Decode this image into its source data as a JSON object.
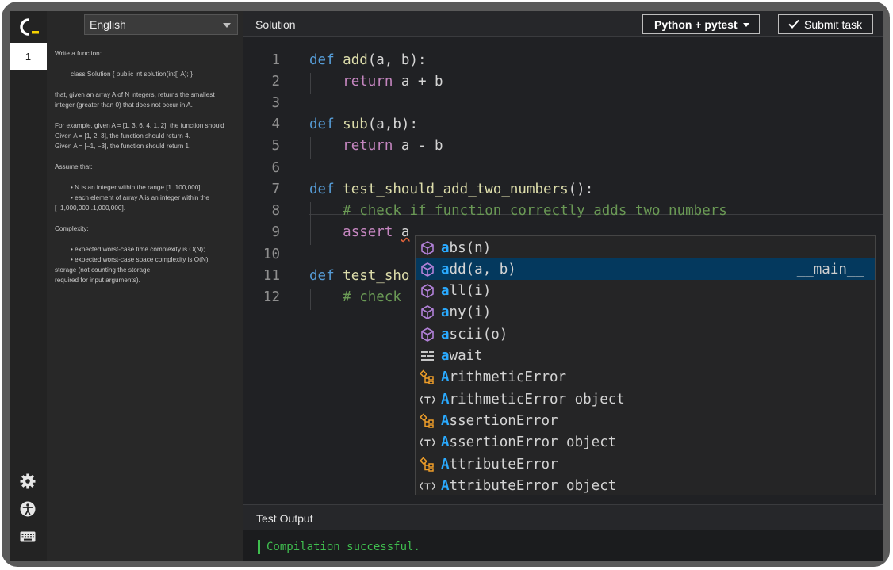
{
  "rail": {
    "task_number": "1"
  },
  "description": {
    "language": "English",
    "lines": [
      "Write a function:",
      "class Solution { public int solution(int[] A); }",
      "that, given an array A of N integers, returns the smallest integer (greater than 0) that does not occur in A.",
      "For example, given A = [1, 3, 6, 4, 1, 2], the function should",
      "Given A = [1, 2, 3], the function should return 4.",
      "Given A = [−1, −3], the function should return 1.",
      "Assume that:",
      "•      N is an integer within the range [1..100,000];",
      "•      each element of array A is an integer within the",
      "[−1,000,000..1,000,000].",
      "Complexity:",
      "•      expected worst-case time complexity is O(N);",
      "•      expected worst-case space complexity is O(N),",
      "storage (not counting the storage",
      "required for input arguments)."
    ]
  },
  "header": {
    "title": "Solution",
    "framework": "Python + pytest",
    "submit_label": "Submit task"
  },
  "editor": {
    "line_numbers": [
      "1",
      "2",
      "3",
      "4",
      "5",
      "6",
      "7",
      "8",
      "9",
      "10",
      "11",
      "12"
    ],
    "code": {
      "l1_kw": "def",
      "l1_fn": "add",
      "l1_rest": "(a, b):",
      "l2_kw": "return",
      "l2_rest": " a + b",
      "l4_kw": "def",
      "l4_fn": "sub",
      "l4_rest": "(a,b):",
      "l5_kw": "return",
      "l5_rest": " a - b",
      "l7_kw": "def",
      "l7_fn": "test_should_add_two_numbers",
      "l7_rest": "():",
      "l8_comment": "# check if function correctly adds two numbers",
      "l9_kw": "assert",
      "l9_var": "a",
      "l11_kw": "def",
      "l11_fn": "test_sho",
      "l12_comment": "# check"
    }
  },
  "suggestions": [
    {
      "icon": "cube-icon",
      "match": "a",
      "rest": "bs(n)",
      "detail": ""
    },
    {
      "icon": "cube-icon",
      "match": "a",
      "rest": "dd(a, b)",
      "detail": "__main__"
    },
    {
      "icon": "cube-icon",
      "match": "a",
      "rest": "ll(i)",
      "detail": ""
    },
    {
      "icon": "cube-icon",
      "match": "a",
      "rest": "ny(i)",
      "detail": ""
    },
    {
      "icon": "cube-icon",
      "match": "a",
      "rest": "scii(o)",
      "detail": ""
    },
    {
      "icon": "keyword-icon",
      "match": "a",
      "rest": "wait",
      "detail": ""
    },
    {
      "icon": "class-icon",
      "match": "A",
      "rest": "rithmeticError",
      "detail": ""
    },
    {
      "icon": "type-param-icon",
      "match": "A",
      "rest": "rithmeticError object",
      "detail": ""
    },
    {
      "icon": "class-icon",
      "match": "A",
      "rest": "ssertionError",
      "detail": ""
    },
    {
      "icon": "type-param-icon",
      "match": "A",
      "rest": "ssertionError object",
      "detail": ""
    },
    {
      "icon": "class-icon",
      "match": "A",
      "rest": "ttributeError",
      "detail": ""
    },
    {
      "icon": "type-param-icon",
      "match": "A",
      "rest": "ttributeError object",
      "detail": ""
    }
  ],
  "test_output": {
    "title": "Test Output",
    "message": "Compilation successful."
  },
  "colors": {
    "accent_yellow": "#f5d100",
    "selection": "#04395e",
    "success": "#3fbf4f"
  }
}
